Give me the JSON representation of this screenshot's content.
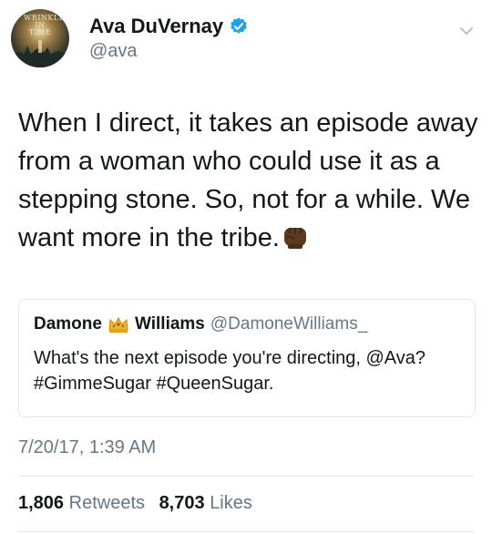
{
  "user": {
    "display_name": "Ava DuVernay",
    "handle": "@ava",
    "avatar_text": "WRINKLE IN TIME"
  },
  "tweet": {
    "text": "When I direct, it takes an episode away from a woman who could use it as a stepping stone. So, not for a while. We want more in the tribe.",
    "timestamp": "7/20/17, 1:39 AM"
  },
  "quoted": {
    "name_first": "Damone",
    "name_last": "Williams",
    "handle": "@DamoneWilliams_",
    "text": "What's the next episode you're directing, @Ava? #GimmeSugar #QueenSugar."
  },
  "stats": {
    "retweets_count": "1,806",
    "retweets_label": "Retweets",
    "likes_count": "8,703",
    "likes_label": "Likes"
  },
  "colors": {
    "text": "#14171a",
    "secondary": "#657786",
    "verified_blue": "#1da1f2",
    "border": "#e1e8ed"
  },
  "icons": [
    "verified-badge-icon",
    "chevron-down-icon",
    "raised-fist-emoji",
    "crown-emoji"
  ]
}
